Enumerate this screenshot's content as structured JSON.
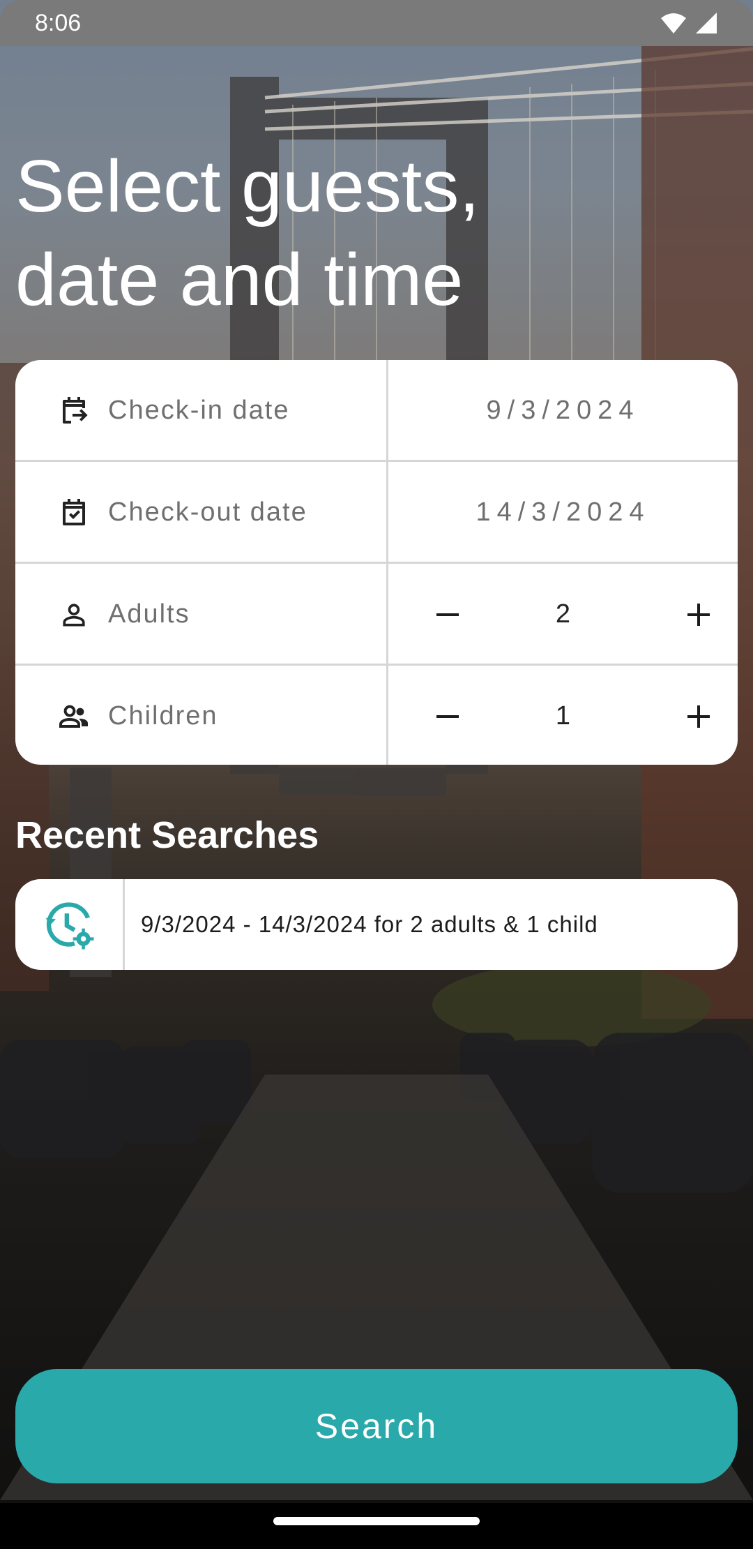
{
  "status_bar": {
    "time": "8:06",
    "icons": [
      "wifi-icon",
      "signal-icon"
    ]
  },
  "headline": {
    "line1": "Select guests,",
    "line2": "date and time"
  },
  "form": {
    "rows": [
      {
        "icon": "calendar-checkin-icon",
        "label": "Check-in date",
        "value": "9/3/2024"
      },
      {
        "icon": "calendar-check-icon",
        "label": "Check-out date",
        "value": "14/3/2024"
      },
      {
        "icon": "person-icon",
        "label": "Adults",
        "value": "2"
      },
      {
        "icon": "group-icon",
        "label": "Children",
        "value": "1"
      }
    ]
  },
  "recent": {
    "title": "Recent Searches",
    "items": [
      {
        "icon": "history-settings-icon",
        "text": "9/3/2024 - 14/3/2024 for 2 adults & 1 child"
      }
    ]
  },
  "search_button": {
    "label": "Search"
  },
  "colors": {
    "accent": "#2aa9ab",
    "card": "#ffffff",
    "label": "#6f6f6f",
    "divider": "#d6d6d6"
  }
}
